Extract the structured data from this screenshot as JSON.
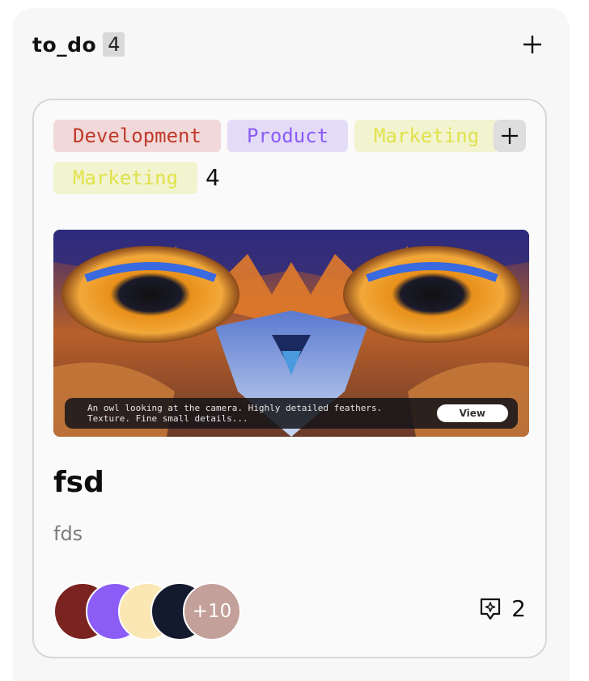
{
  "column": {
    "title": "to_do",
    "count": "4",
    "add_icon": "plus-icon"
  },
  "card": {
    "tags": [
      {
        "label": "Development",
        "bg": "#f1d9d9",
        "color": "#c0392b"
      },
      {
        "label": "Product",
        "bg": "#e4dcf6",
        "color": "#8b5cf6"
      },
      {
        "label": "Marketing",
        "bg": "#f2f3cf",
        "color": "#e0e34a"
      },
      {
        "label": "Marketing",
        "bg": "#f2f3cf",
        "color": "#e0e34a"
      }
    ],
    "tag_overflow_count": "4",
    "add_tag_icon": "plus-icon",
    "cover_caption": "An owl looking at the camera. Highly detailed feathers. Texture. Fine small details...",
    "cover_button": "View",
    "title": "fsd",
    "description": "fds",
    "avatars": [
      {
        "color": "#7a2320"
      },
      {
        "color": "#8b5cf6"
      },
      {
        "color": "#fbe7b4"
      },
      {
        "color": "#141a2e"
      }
    ],
    "avatars_more": "+10",
    "avatars_more_color": "#c4a09a",
    "comment_icon": "comment-sparkle-icon",
    "comment_count": "2"
  }
}
